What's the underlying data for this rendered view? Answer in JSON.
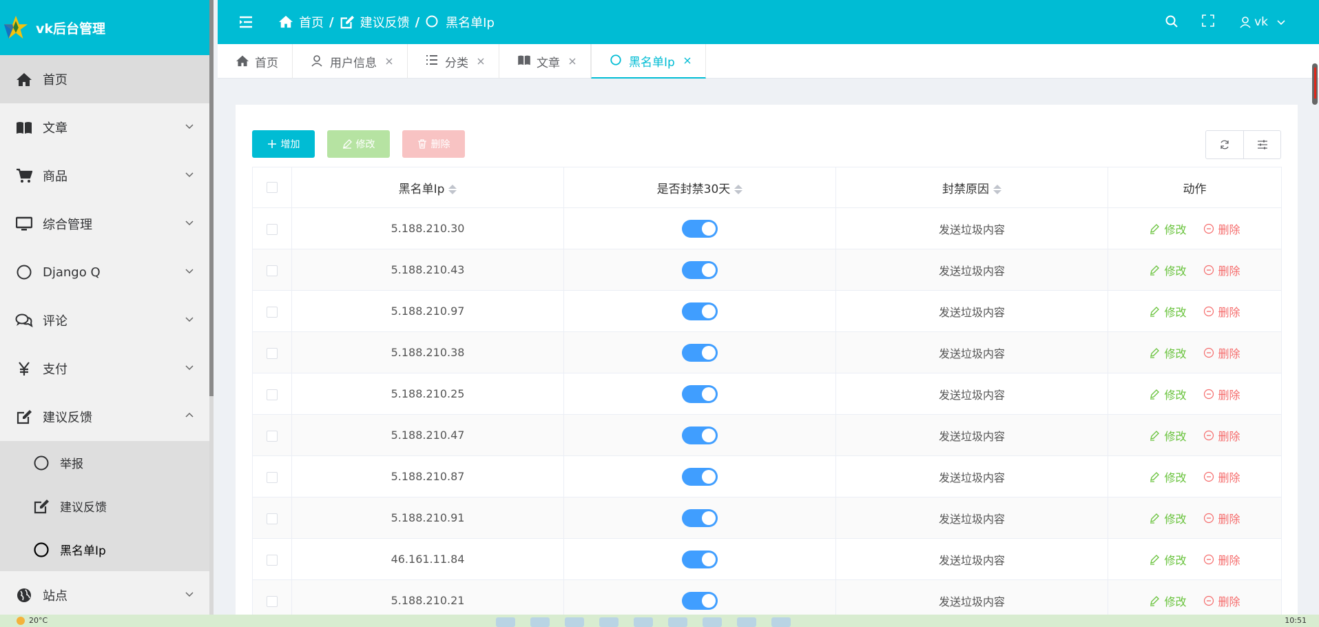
{
  "brand": {
    "name": "vk后台管理"
  },
  "sidebar": {
    "items": [
      {
        "label": "首页",
        "icon": "home-icon",
        "active": true,
        "has_children": false
      },
      {
        "label": "文章",
        "icon": "book-icon",
        "has_children": true
      },
      {
        "label": "商品",
        "icon": "cart-icon",
        "has_children": true
      },
      {
        "label": "综合管理",
        "icon": "monitor-icon",
        "has_children": true
      },
      {
        "label": "Django Q",
        "icon": "circle-icon",
        "has_children": true
      },
      {
        "label": "评论",
        "icon": "comments-icon",
        "has_children": true
      },
      {
        "label": "支付",
        "icon": "yen-icon",
        "has_children": true
      },
      {
        "label": "建议反馈",
        "icon": "edit-icon",
        "has_children": true,
        "expanded": true
      },
      {
        "label": "站点",
        "icon": "globe-icon",
        "has_children": true
      }
    ],
    "feedback_children": [
      {
        "label": "举报",
        "icon": "circle-icon"
      },
      {
        "label": "建议反馈",
        "icon": "edit-icon"
      },
      {
        "label": "黑名单Ip",
        "icon": "circle-icon",
        "active": true
      }
    ]
  },
  "header": {
    "breadcrumb": [
      {
        "label": "首页",
        "icon": "home-icon"
      },
      {
        "label": "建议反馈",
        "icon": "edit-icon"
      },
      {
        "label": "黑名单Ip",
        "icon": "circle-icon"
      }
    ],
    "separator": "/",
    "user": "vk"
  },
  "tabs": [
    {
      "label": "首页",
      "icon": "home-icon",
      "closable": false
    },
    {
      "label": "用户信息",
      "icon": "user-icon",
      "closable": true
    },
    {
      "label": "分类",
      "icon": "list-icon",
      "closable": true
    },
    {
      "label": "文章",
      "icon": "book-icon",
      "closable": true
    },
    {
      "label": "黑名单Ip",
      "icon": "circle-icon",
      "closable": true,
      "active": true
    }
  ],
  "toolbar": {
    "add_label": "增加",
    "edit_label": "修改",
    "delete_label": "删除"
  },
  "table": {
    "columns": [
      "黑名单Ip",
      "是否封禁30天",
      "封禁原因",
      "动作"
    ],
    "rows": [
      {
        "ip": "5.188.210.30",
        "banned": true,
        "reason": "发送垃圾内容"
      },
      {
        "ip": "5.188.210.43",
        "banned": true,
        "reason": "发送垃圾内容"
      },
      {
        "ip": "5.188.210.97",
        "banned": true,
        "reason": "发送垃圾内容"
      },
      {
        "ip": "5.188.210.38",
        "banned": true,
        "reason": "发送垃圾内容"
      },
      {
        "ip": "5.188.210.25",
        "banned": true,
        "reason": "发送垃圾内容"
      },
      {
        "ip": "5.188.210.47",
        "banned": true,
        "reason": "发送垃圾内容"
      },
      {
        "ip": "5.188.210.87",
        "banned": true,
        "reason": "发送垃圾内容"
      },
      {
        "ip": "5.188.210.91",
        "banned": true,
        "reason": "发送垃圾内容"
      },
      {
        "ip": "46.161.11.84",
        "banned": true,
        "reason": "发送垃圾内容"
      },
      {
        "ip": "5.188.210.21",
        "banned": true,
        "reason": "发送垃圾内容"
      }
    ],
    "row_edit": "修改",
    "row_delete": "删除"
  },
  "taskbar": {
    "weather": "20°C",
    "time": "10:51"
  },
  "colors": {
    "brand": "#00bcd4",
    "switch_on": "#409eff",
    "edit": "#67c23a",
    "delete": "#f56c6c"
  }
}
